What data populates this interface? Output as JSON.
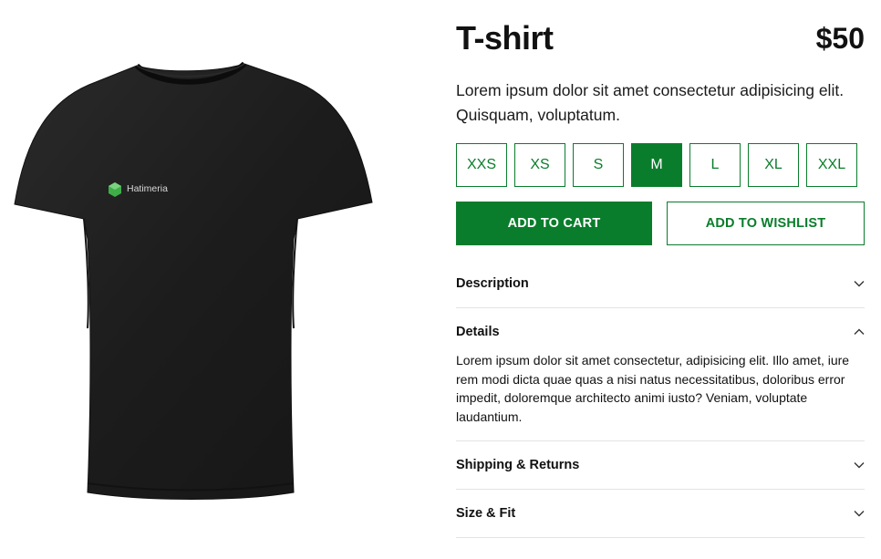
{
  "product": {
    "title": "T-shirt",
    "price": "$50",
    "tagline": "Lorem ipsum dolor sit amet consectetur adipisicing elit. Quisquam, voluptatum.",
    "image": {
      "brand_text": "Hatimeria",
      "icon": "tshirt-image"
    }
  },
  "sizes": {
    "options": [
      "XXS",
      "XS",
      "S",
      "M",
      "L",
      "XL",
      "XXL"
    ],
    "selected": "M"
  },
  "actions": {
    "add_to_cart": "ADD TO CART",
    "add_to_wishlist": "ADD TO WISHLIST"
  },
  "accordion": [
    {
      "title": "Description",
      "expanded": false,
      "icon": "chevron-down-icon"
    },
    {
      "title": "Details",
      "expanded": true,
      "icon": "chevron-up-icon",
      "body": "Lorem ipsum dolor sit amet consectetur, adipisicing elit. Illo amet, iure rem modi dicta quae quas a nisi natus necessitatibus, doloribus error impedit, doloremque architecto animi iusto? Veniam, voluptate laudantium."
    },
    {
      "title": "Shipping & Returns",
      "expanded": false,
      "icon": "chevron-down-icon"
    },
    {
      "title": "Size & Fit",
      "expanded": false,
      "icon": "chevron-down-icon"
    }
  ],
  "colors": {
    "accent": "#0a7d2c",
    "shirt": "#1c1c1c",
    "logo": "#3fae49"
  }
}
